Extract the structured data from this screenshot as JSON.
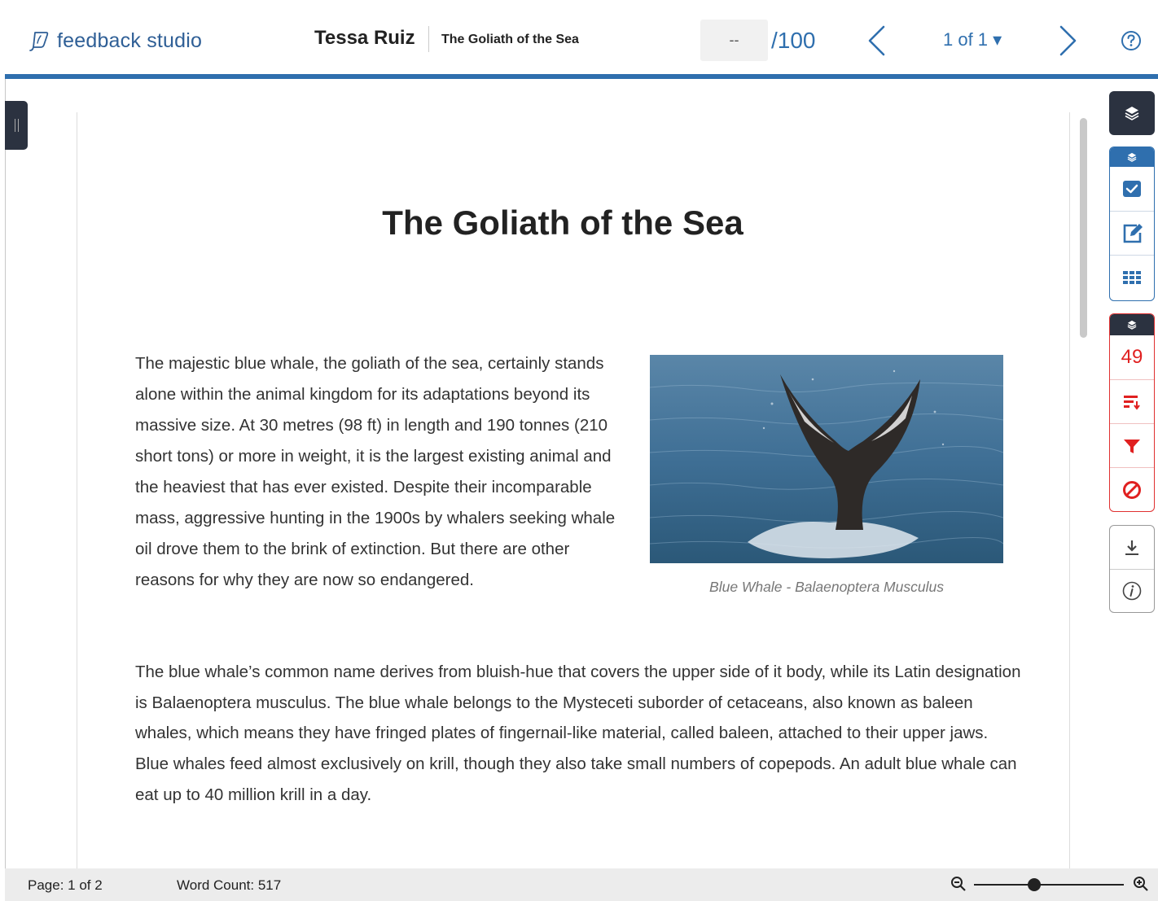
{
  "header": {
    "brand": "feedback studio",
    "student": "Tessa Ruiz",
    "paper_title": "The Goliath of the Sea",
    "score_value": "--",
    "score_max": "/100",
    "pager": "1 of 1 ▾"
  },
  "document": {
    "title": "The Goliath of the Sea",
    "paragraph1": "The majestic blue whale, the goliath of the sea, certainly stands alone within the animal kingdom for its adaptations beyond its massive size. At 30 metres (98 ft) in length and 190 tonnes (210 short tons) or more in weight, it is the largest existing animal and the heaviest that has ever existed. Despite their incomparable mass, aggressive hunting in the 1900s by whalers seeking whale oil drove them to the brink of extinction. But there are other reasons for why they are now so endangered.",
    "caption": "Blue Whale - Balaenoptera Musculus",
    "paragraph2": "The blue whale’s common name derives from bluish-hue that covers the upper side of it body, while its Latin designation is Balaenoptera musculus. The blue whale belongs to the Mysteceti suborder of cetaceans, also known as baleen whales, which means they have fringed plates of fingernail-like material, called baleen, attached to their upper jaws. Blue whales feed almost exclusively on krill, though they also take small numbers of copepods. An adult blue whale can eat up to 40 million krill in a day."
  },
  "toolbar": {
    "similarity_count": "49"
  },
  "footer": {
    "page": "Page: 1 of 2",
    "word_count": "Word Count: 517"
  },
  "zoom": {
    "level": 0.4
  },
  "colors": {
    "accent": "#2f6fae",
    "dark": "#2b3240",
    "alert": "#e02020"
  }
}
